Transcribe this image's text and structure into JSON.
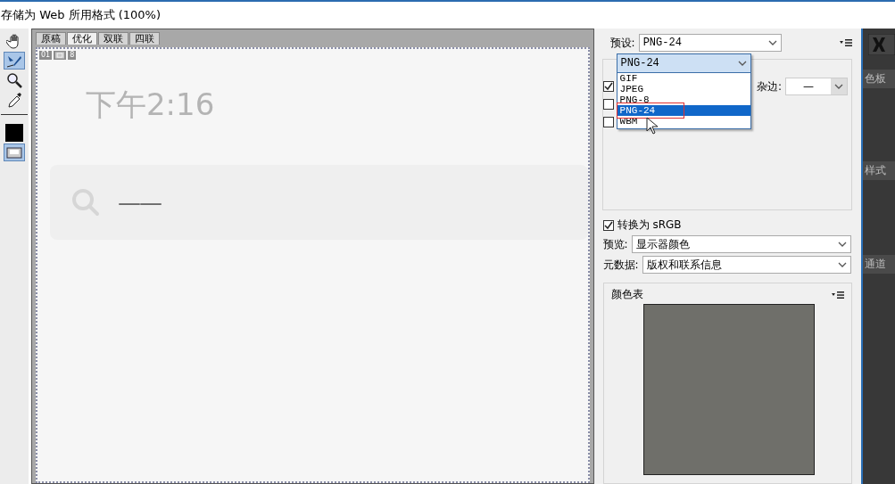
{
  "window": {
    "title": "存储为 Web 所用格式 (100%)"
  },
  "tools": [
    {
      "kind": "hand",
      "selected": false
    },
    {
      "kind": "slice",
      "selected": true
    },
    {
      "kind": "zoom",
      "selected": false
    },
    {
      "kind": "eyedropper",
      "selected": false
    },
    {
      "kind": "swatch",
      "color": "#000000"
    },
    {
      "kind": "slices-toggle",
      "selected": true
    }
  ],
  "view_tabs": [
    {
      "label": "原稿",
      "selected": false
    },
    {
      "label": "优化",
      "selected": true
    },
    {
      "label": "双联",
      "selected": false
    },
    {
      "label": "四联",
      "selected": false
    }
  ],
  "preview": {
    "slice_number": "01",
    "slice_count": "8",
    "time": "下午2:16",
    "search_text": "——"
  },
  "settings": {
    "preset_label": "预设:",
    "preset_value": "PNG-24",
    "format_value": "PNG-24",
    "format_options": [
      {
        "label": "GIF",
        "selected": false
      },
      {
        "label": "JPEG",
        "selected": false
      },
      {
        "label": "PNG-8",
        "selected": false
      },
      {
        "label": "PNG-24",
        "selected": true
      },
      {
        "label": "WBM",
        "selected": false
      }
    ],
    "checkboxes": [
      {
        "checked": true
      },
      {
        "checked": false
      },
      {
        "checked": false
      }
    ],
    "matte_label": "杂边:",
    "matte_value": "—",
    "convert_srgb": {
      "label": "转换为 sRGB",
      "checked": true
    },
    "preview_label": "预览:",
    "preview_value": "显示器颜色",
    "metadata_label": "元数据:",
    "metadata_value": "版权和联系信息",
    "color_table": {
      "title": "颜色表"
    }
  },
  "side_panels": [
    {
      "label": "色板"
    },
    {
      "label": "样式"
    },
    {
      "label": "通道"
    }
  ]
}
